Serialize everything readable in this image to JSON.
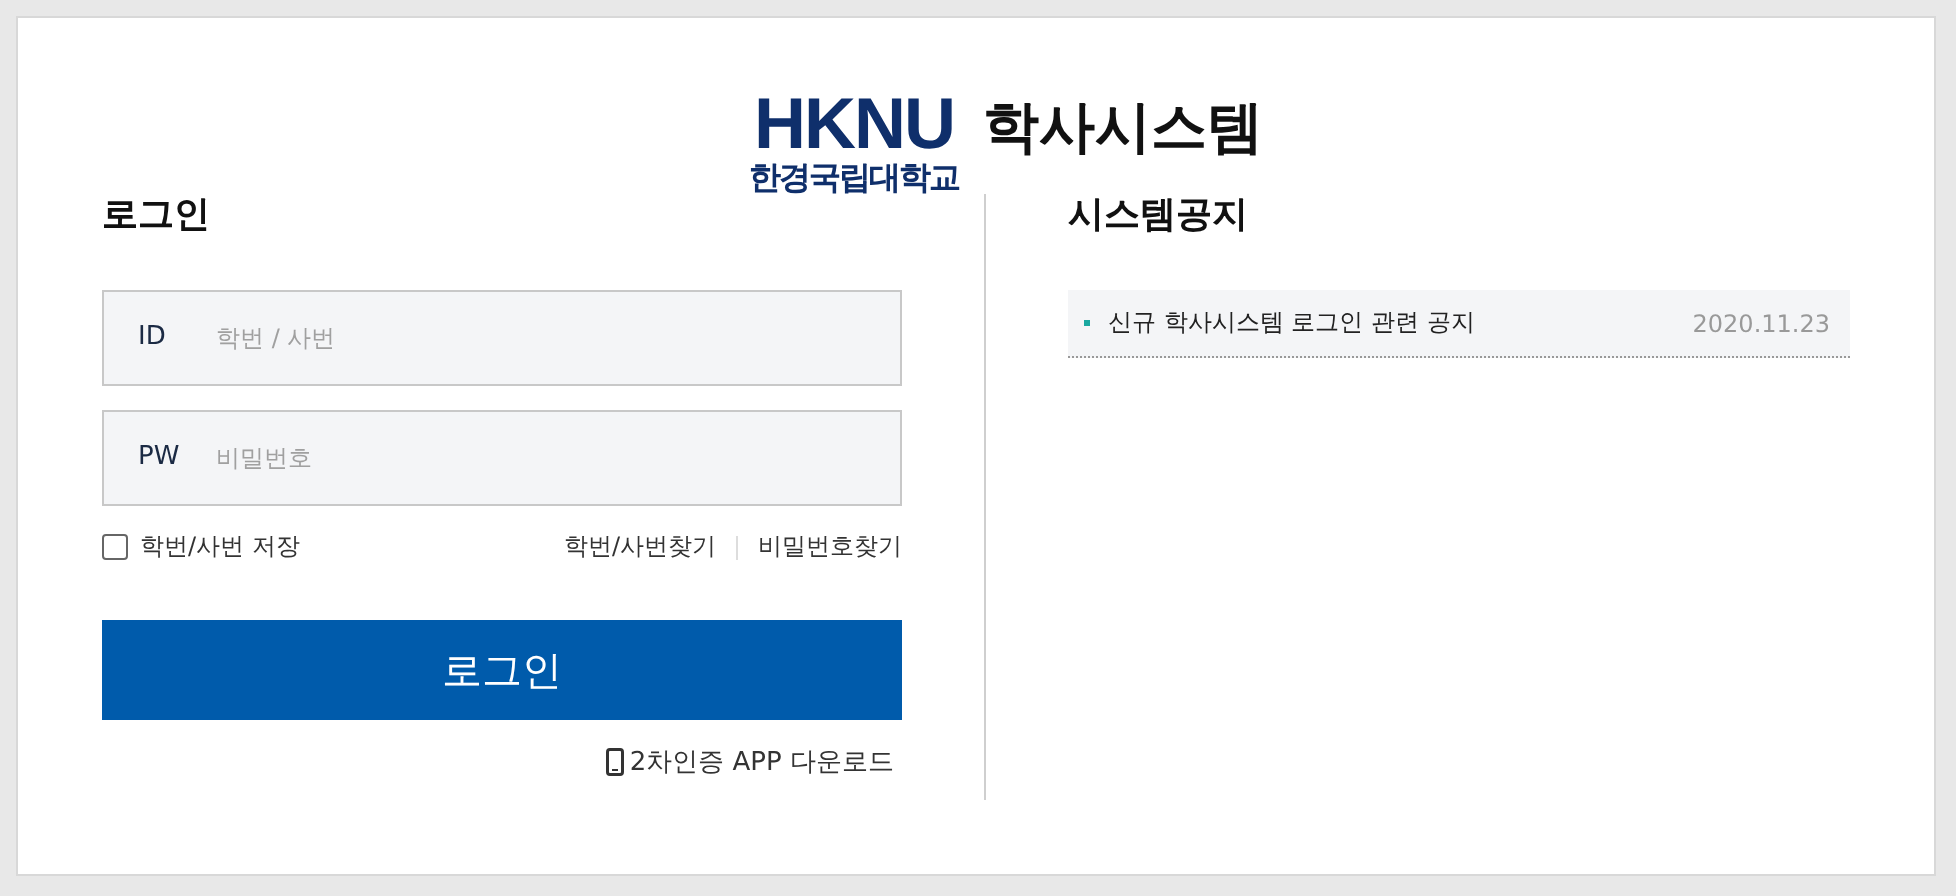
{
  "header": {
    "logo": "HKNU",
    "university": "한경국립대학교",
    "title": "학사시스템"
  },
  "login": {
    "heading": "로그인",
    "fields": [
      {
        "label": "ID",
        "placeholder": "학번 / 사번"
      },
      {
        "label": "PW",
        "placeholder": "비밀번호"
      }
    ],
    "remember": {
      "label": "학번/사번 저장",
      "checked": false
    },
    "links": [
      "학번/사번찾기",
      "비밀번호찾기"
    ],
    "button": "로그인",
    "app_link": "2차인증 APP 다운로드"
  },
  "notices": {
    "heading": "시스템공지",
    "items": [
      {
        "title": "신규 학사시스템 로그인 관련 공지",
        "date": "2020.11.23"
      }
    ]
  }
}
